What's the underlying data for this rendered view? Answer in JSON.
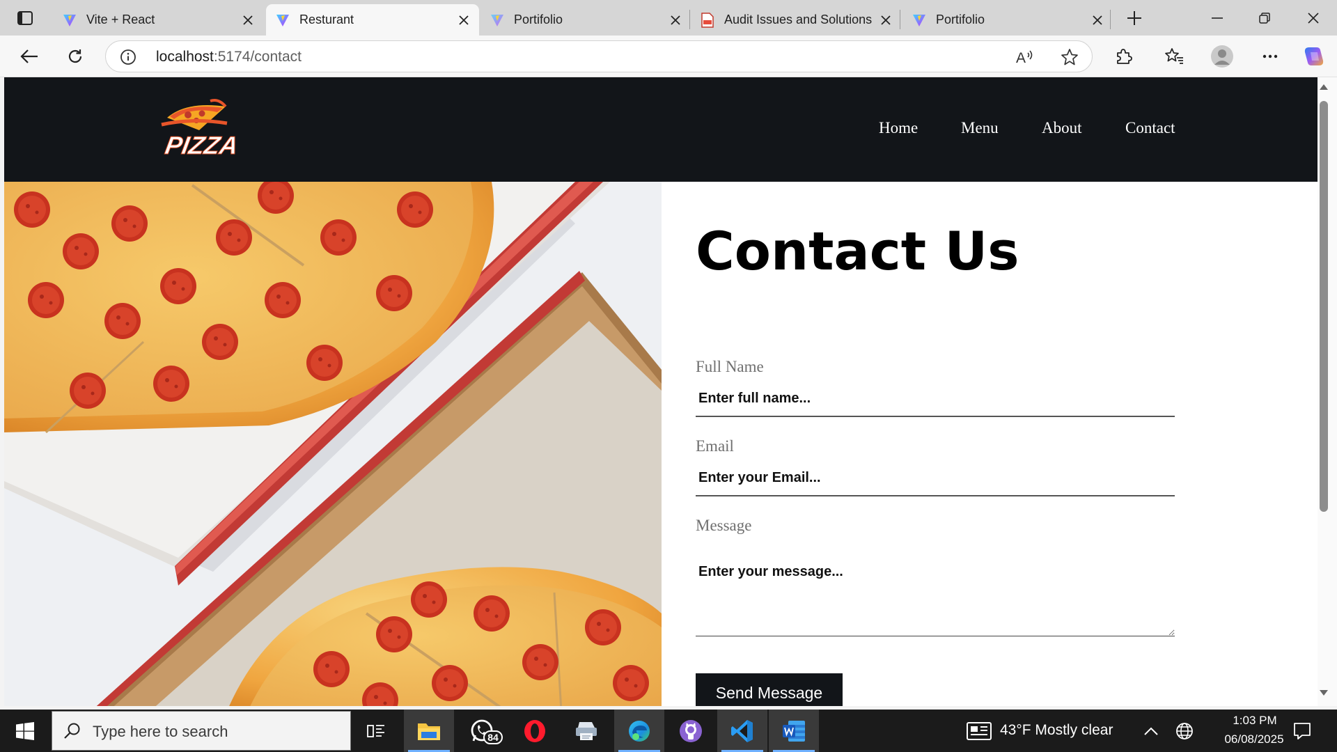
{
  "browser": {
    "tabs": [
      {
        "title": "Vite + React",
        "icon": "vite-icon"
      },
      {
        "title": "Resturant",
        "icon": "vite-icon",
        "active": true
      },
      {
        "title": "Portifolio",
        "icon": "vite-icon"
      },
      {
        "title": "Audit Issues and Solutions",
        "icon": "pdf-icon"
      },
      {
        "title": "Portifolio",
        "icon": "vite-icon"
      }
    ],
    "url_host": "localhost",
    "url_path": ":5174/contact"
  },
  "site": {
    "logo_text": "PIZZA",
    "nav": [
      "Home",
      "Menu",
      "About",
      "Contact"
    ],
    "contact": {
      "title": "Contact Us",
      "name_label": "Full Name",
      "name_placeholder": "Enter full name...",
      "email_label": "Email",
      "email_placeholder": "Enter your Email...",
      "message_label": "Message",
      "message_placeholder": "Enter your message...",
      "send_label": "Send Message"
    }
  },
  "taskbar": {
    "search_placeholder": "Type here to search",
    "whatsapp_badge": "84",
    "weather": "43°F  Mostly clear",
    "time": "1:03 PM",
    "date": "06/08/2025"
  },
  "colors": {
    "nav_background": "#121519",
    "button_background": "#121519",
    "accent": "#0067c0"
  }
}
